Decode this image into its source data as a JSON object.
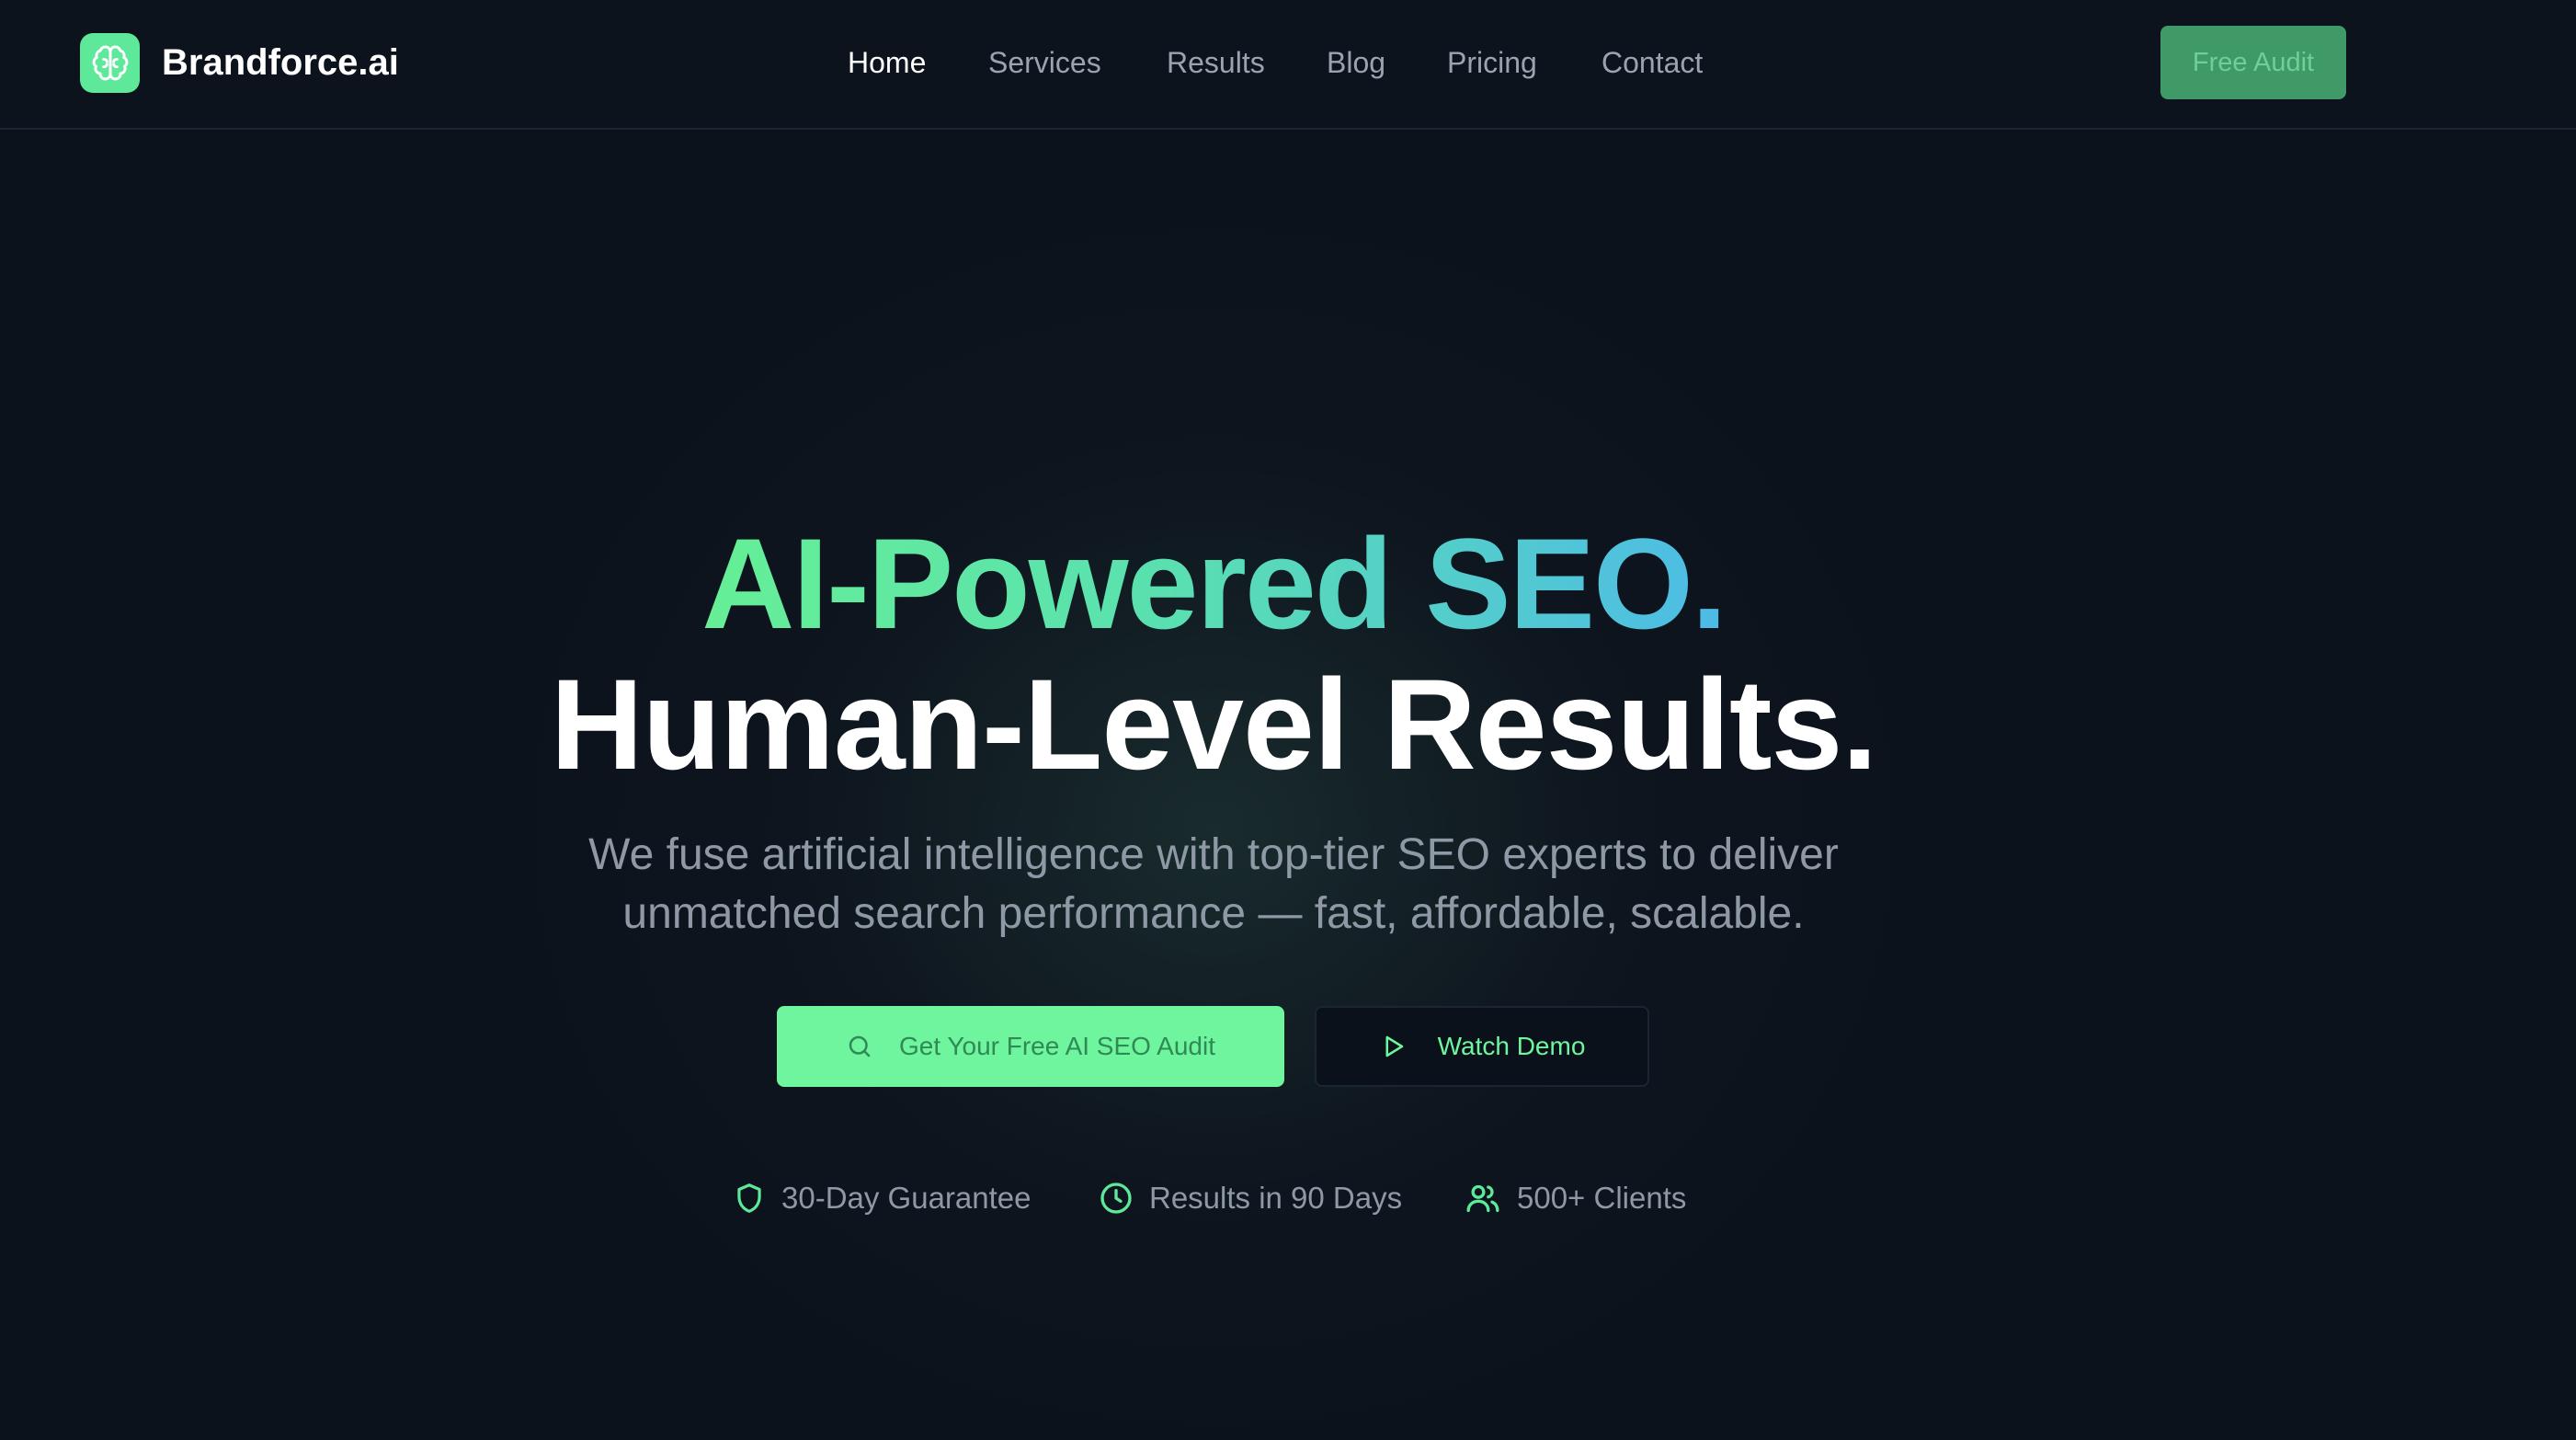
{
  "brand": {
    "name": "Brandforce.ai",
    "logo_icon": "brain-icon",
    "accent": "#5ee89a"
  },
  "nav": {
    "items": [
      {
        "label": "Home",
        "active": true
      },
      {
        "label": "Services"
      },
      {
        "label": "Results"
      },
      {
        "label": "Blog"
      },
      {
        "label": "Pricing"
      },
      {
        "label": "Contact"
      }
    ],
    "cta_label": "Free Audit"
  },
  "hero": {
    "headline_line1": "AI-Powered SEO.",
    "headline_line2": "Human-Level Results.",
    "subtitle_line1": "We fuse artificial intelligence with top-tier SEO experts to deliver",
    "subtitle_line2": "unmatched search performance — fast, affordable, scalable.",
    "primary_cta": {
      "label": "Get Your Free AI SEO Audit",
      "icon": "search-icon"
    },
    "secondary_cta": {
      "label": "Watch Demo",
      "icon": "play-icon"
    },
    "gradient_colors": [
      "#66ef96",
      "#4dbbe6"
    ]
  },
  "badges": [
    {
      "label": "30-Day Guarantee",
      "icon": "shield-icon"
    },
    {
      "label": "Results in 90 Days",
      "icon": "clock-icon"
    },
    {
      "label": "500+ Clients",
      "icon": "users-icon"
    }
  ]
}
